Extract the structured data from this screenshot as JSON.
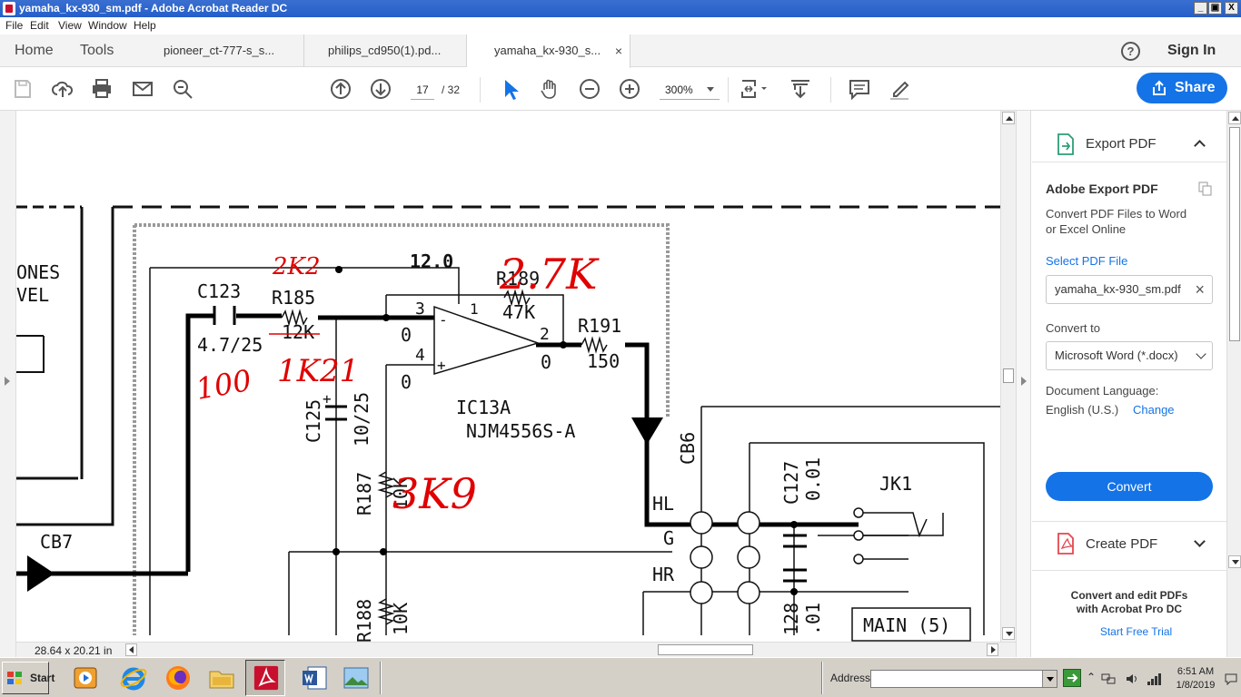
{
  "window": {
    "title": "yamaha_kx-930_sm.pdf - Adobe Acrobat Reader DC",
    "min": "_",
    "max": "▣",
    "close": "X"
  },
  "menu": [
    "File",
    "Edit",
    "View",
    "Window",
    "Help"
  ],
  "nav": {
    "home": "Home",
    "tools": "Tools"
  },
  "tabs": [
    {
      "label": "pioneer_ct-777-s_s..."
    },
    {
      "label": "philips_cd950(1).pd..."
    },
    {
      "label": "yamaha_kx-930_s...",
      "close": "×"
    }
  ],
  "help_label": "?",
  "signin": "Sign In",
  "toolbar": {
    "page_current": "17",
    "page_total": "/  32",
    "zoom": "300%",
    "share": "Share"
  },
  "status": {
    "dimensions": "28.64 x 20.21 in"
  },
  "schematic": {
    "labels": [
      "ONES",
      "VEL",
      "C123",
      "R185",
      "12K",
      "4.7/25",
      "12.0",
      "R189",
      "47K",
      "R191",
      "150",
      "IC13A",
      "NJM4556S-A",
      "C125",
      "10/25",
      "R187",
      "10K",
      "CB7",
      "CB6",
      "HL",
      "G",
      "HR",
      "C127",
      "0.01",
      "JK1",
      "R188",
      "10K",
      "128",
      ".01",
      "MAIN (5)",
      "3",
      "1",
      "2",
      "4",
      "0",
      "0",
      "0",
      "0",
      "+",
      "+",
      "-"
    ],
    "handwriting": [
      "2K2",
      "2.7K",
      "1K21",
      "100",
      "3K9"
    ]
  },
  "panel": {
    "export_title": "Export PDF",
    "heading": "Adobe Export PDF",
    "desc": "Convert PDF Files to Word or Excel Online",
    "select_label": "Select PDF File",
    "file": "yamaha_kx-930_sm.pdf",
    "convert_to": "Convert to",
    "format": "Microsoft Word (*.docx)",
    "lang_label": "Document Language:",
    "lang": "English (U.S.)",
    "change": "Change",
    "convert": "Convert",
    "create_title": "Create PDF",
    "promo": "Convert and edit PDFs with Acrobat Pro DC",
    "trial": "Start Free Trial"
  },
  "taskbar": {
    "start": "Start",
    "address": "Address",
    "time": "6:51 AM",
    "date": "1/8/2019"
  }
}
